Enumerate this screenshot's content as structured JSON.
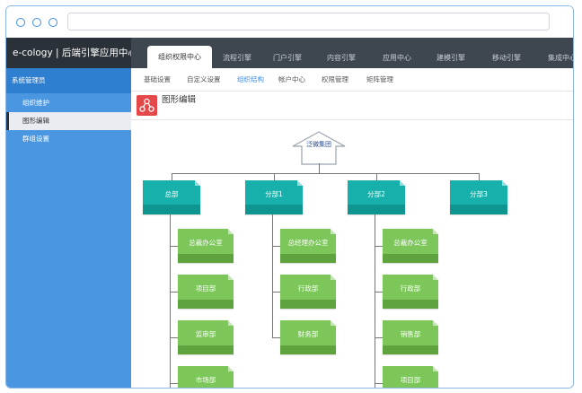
{
  "app": {
    "brand": "e-cology | 后端引擎应用中心"
  },
  "topTabs": [
    {
      "label": "组织权限中心",
      "active": true
    },
    {
      "label": "流程引擎",
      "active": false
    },
    {
      "label": "门户引擎",
      "active": false
    },
    {
      "label": "内容引擎",
      "active": false
    },
    {
      "label": "应用中心",
      "active": false
    },
    {
      "label": "建模引擎",
      "active": false
    },
    {
      "label": "移动引擎",
      "active": false
    },
    {
      "label": "集成中心",
      "active": false
    }
  ],
  "sidebar": {
    "header": "系统管理员",
    "items": [
      {
        "label": "组织维护",
        "active": false
      },
      {
        "label": "图形编辑",
        "active": true
      },
      {
        "label": "群组设置",
        "active": false
      }
    ]
  },
  "subNav": [
    {
      "label": "基础设置",
      "active": false
    },
    {
      "label": "自定义设置",
      "active": false
    },
    {
      "label": "组织结构",
      "active": true
    },
    {
      "label": "帐户中心",
      "active": false
    },
    {
      "label": "权限管理",
      "active": false
    },
    {
      "label": "矩阵管理",
      "active": false
    }
  ],
  "page": {
    "title": "图形编辑"
  },
  "org": {
    "root": "泛微集团",
    "departments": [
      {
        "name": "总部",
        "children": [
          "总裁办公室",
          "项目部",
          "监审部",
          "市场部"
        ]
      },
      {
        "name": "分部1",
        "children": [
          "总经理办公室",
          "行政部",
          "财务部"
        ]
      },
      {
        "name": "分部2",
        "children": [
          "总裁办公室",
          "行政部",
          "销售部",
          "项目部"
        ]
      },
      {
        "name": "分部3",
        "children": []
      }
    ]
  },
  "colors": {
    "accent": "#3f8ee6",
    "dept": "#17b0aa",
    "unit": "#7cc65a",
    "appbar": "#3e4650",
    "sidebar": "#4a96e0"
  }
}
